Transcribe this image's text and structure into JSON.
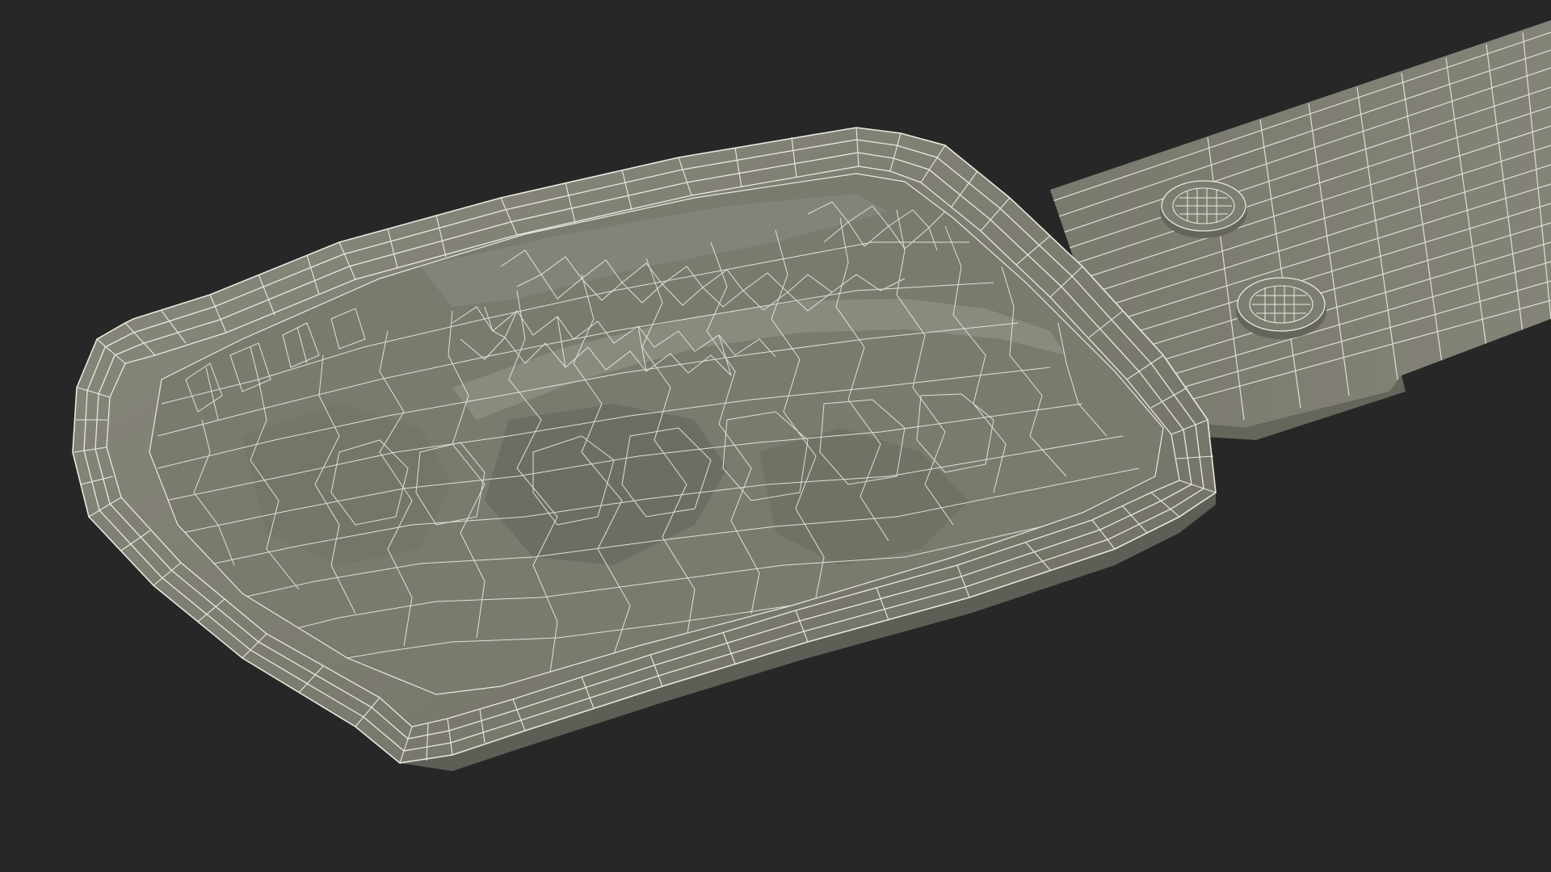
{
  "scene": {
    "subject": "wireframe-3d-model",
    "background_color": "#272727",
    "mesh_fill_color": "#7f7e73",
    "mesh_dark_color": "#6d6c62",
    "mesh_light_color": "#8c8b80",
    "wire_color": "#e9eadf",
    "has_text": false
  }
}
